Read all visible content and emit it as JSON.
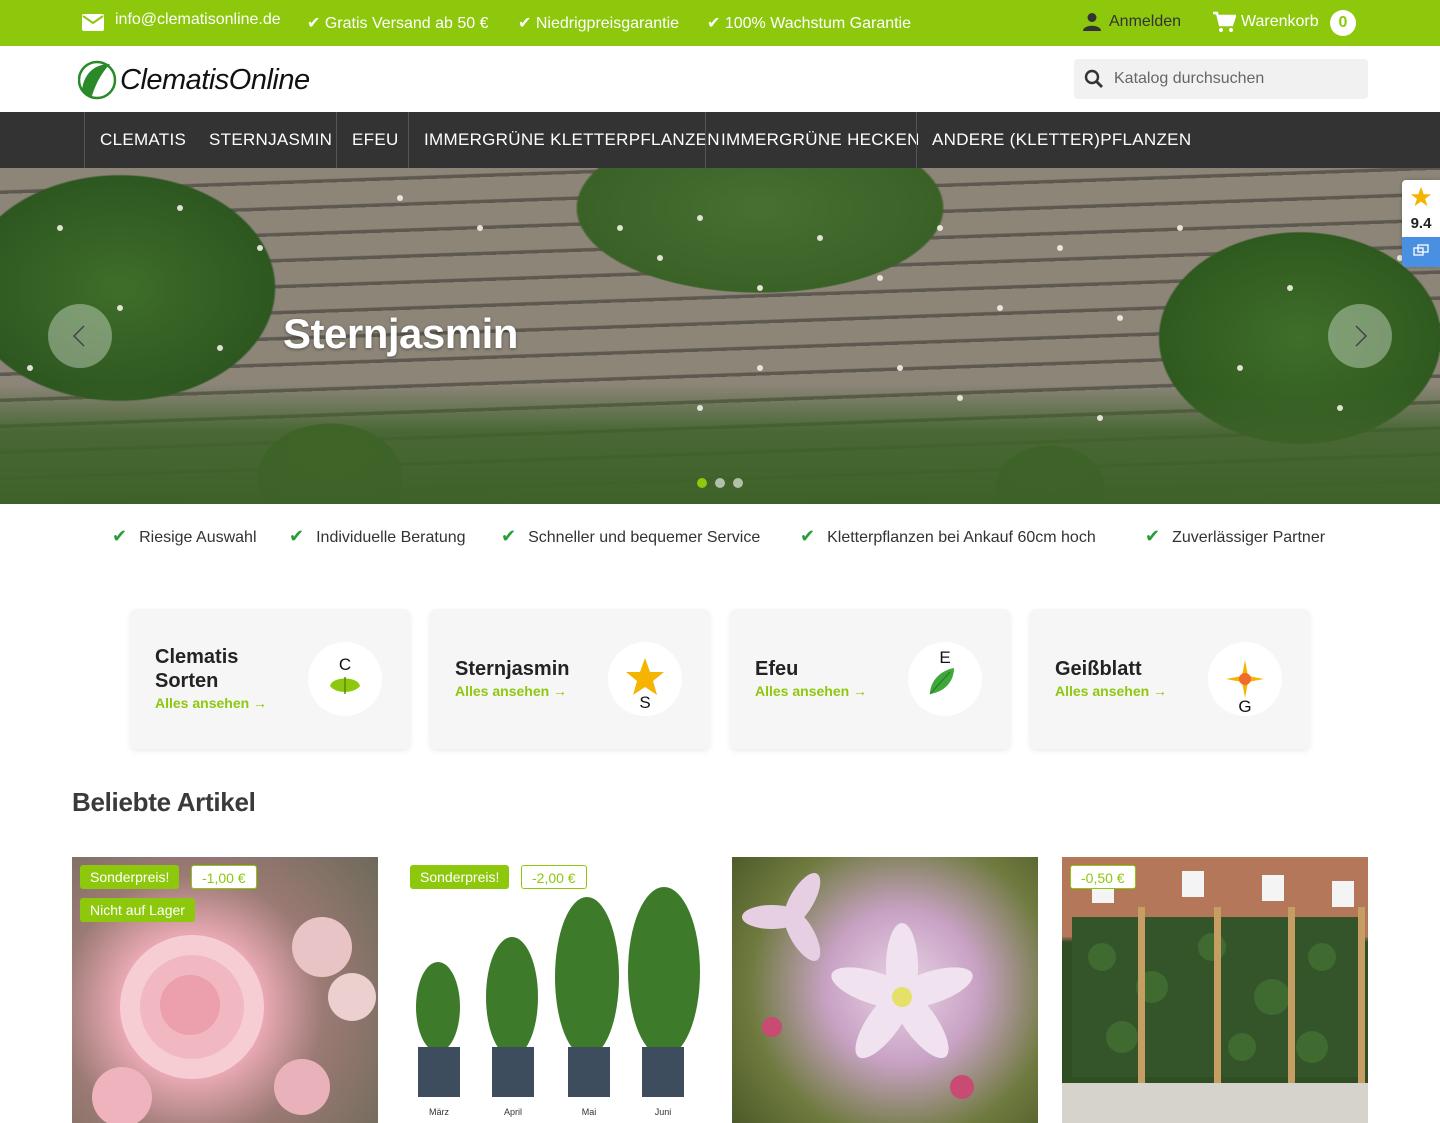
{
  "topbar": {
    "email": "info@clematisonline.de",
    "usp1": "✔ Gratis Versand ab 50 €",
    "usp2": "✔ Niedrigpreisgarantie",
    "usp3": "✔ 100% Wachstum Garantie",
    "login": "Anmelden",
    "cart": "Warenkorb",
    "cart_count": "0"
  },
  "header": {
    "logo_text": "ClematisOnline",
    "search_placeholder": "Katalog durchsuchen"
  },
  "nav": {
    "items": [
      "CLEMATIS",
      "STERNJASMIN",
      "EFEU",
      "IMMERGRÜNE KLETTERPFLANZEN",
      "IMMERGRÜNE HECKEN",
      "ANDERE (KLETTER)PFLANZEN"
    ]
  },
  "hero": {
    "title": "Sternjasmin",
    "slides": 3,
    "active_slide": 1
  },
  "rating": {
    "score": "9.4"
  },
  "usps": [
    "Riesige Auswahl",
    "Individuelle Beratung",
    "Schneller und bequemer Service",
    "Kletterpflanzen bei Ankauf 60cm hoch",
    "Zuverlässiger Partner"
  ],
  "categories": [
    {
      "title": "Clematis Sorten",
      "link": "Alles ansehen →",
      "letter": "C"
    },
    {
      "title": "Sternjasmin",
      "link": "Alles ansehen →",
      "letter": "S"
    },
    {
      "title": "Efeu",
      "link": "Alles ansehen →",
      "letter": "E"
    },
    {
      "title": "Geißblatt",
      "link": "Alles ansehen →",
      "letter": "G"
    }
  ],
  "popular": {
    "title": "Beliebte Artikel",
    "products": [
      {
        "badges": [
          "Sonderpreis!",
          "-1,00 €",
          "Nicht auf Lager"
        ]
      },
      {
        "badges": [
          "Sonderpreis!",
          "-2,00 €"
        ],
        "image_labels": [
          "März",
          "April",
          "Mai",
          "Juni"
        ]
      },
      {
        "badges": []
      },
      {
        "badges": [
          "-0,50 €"
        ]
      }
    ]
  },
  "colors": {
    "brand_green": "#8dc80d",
    "nav_bg": "#333333",
    "check_green": "#2a9d3a"
  }
}
